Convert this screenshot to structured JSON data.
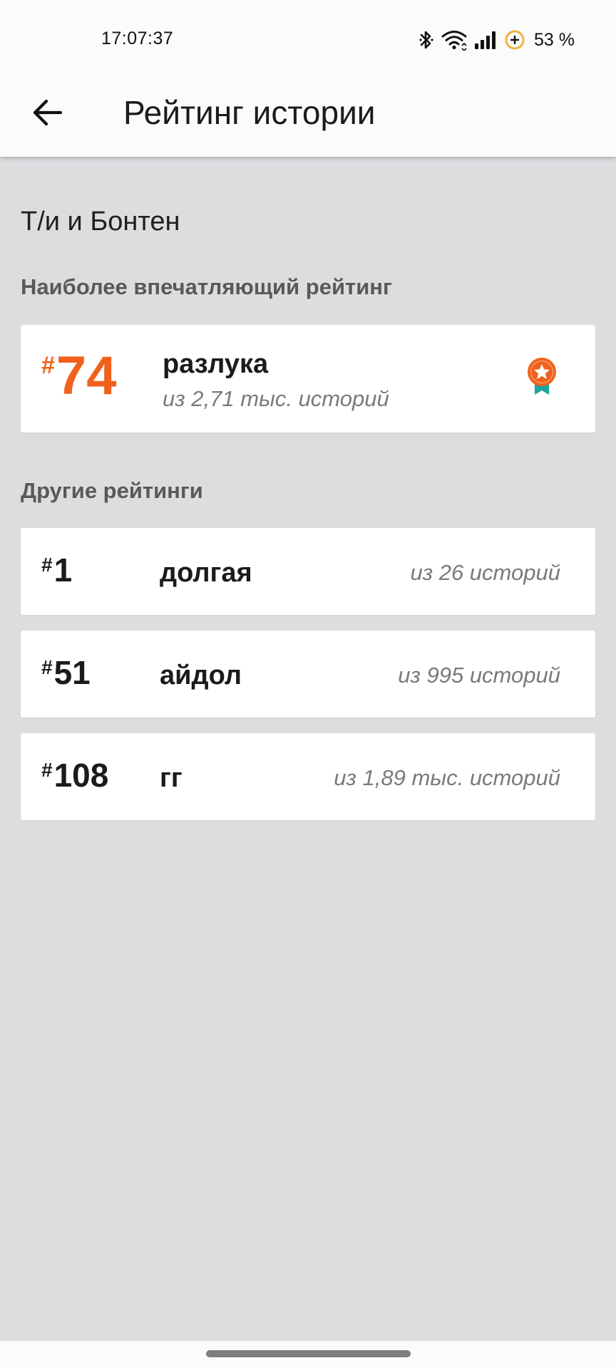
{
  "status_bar": {
    "time": "17:07:37",
    "battery": "53 %",
    "icons": [
      "bluetooth-icon",
      "wifi-icon",
      "signal-icon",
      "battery-saver-icon"
    ]
  },
  "app_bar": {
    "title": "Рейтинг истории",
    "back_icon": "arrow-left-icon"
  },
  "story": {
    "title": "Т/и и Бонтен"
  },
  "best_ranking": {
    "heading": "Наиболее впечатляющий рейтинг",
    "hash": "#",
    "rank": "74",
    "tag": "разлука",
    "subtitle": "из 2,71 тыс. историй",
    "icon": "award-ribbon-icon"
  },
  "other_rankings": {
    "heading": "Другие рейтинги",
    "items": [
      {
        "hash": "#",
        "rank": "1",
        "tag": "долгая",
        "count": "из 26 историй"
      },
      {
        "hash": "#",
        "rank": "51",
        "tag": "айдол",
        "count": "из 995 историй"
      },
      {
        "hash": "#",
        "rank": "108",
        "tag": "гг",
        "count": "из 1,89 тыс. историй"
      }
    ]
  },
  "colors": {
    "accent": "#f0611c",
    "background": "#dedcdf",
    "card": "#ffffff",
    "ribbon": "#1aa5a0"
  }
}
